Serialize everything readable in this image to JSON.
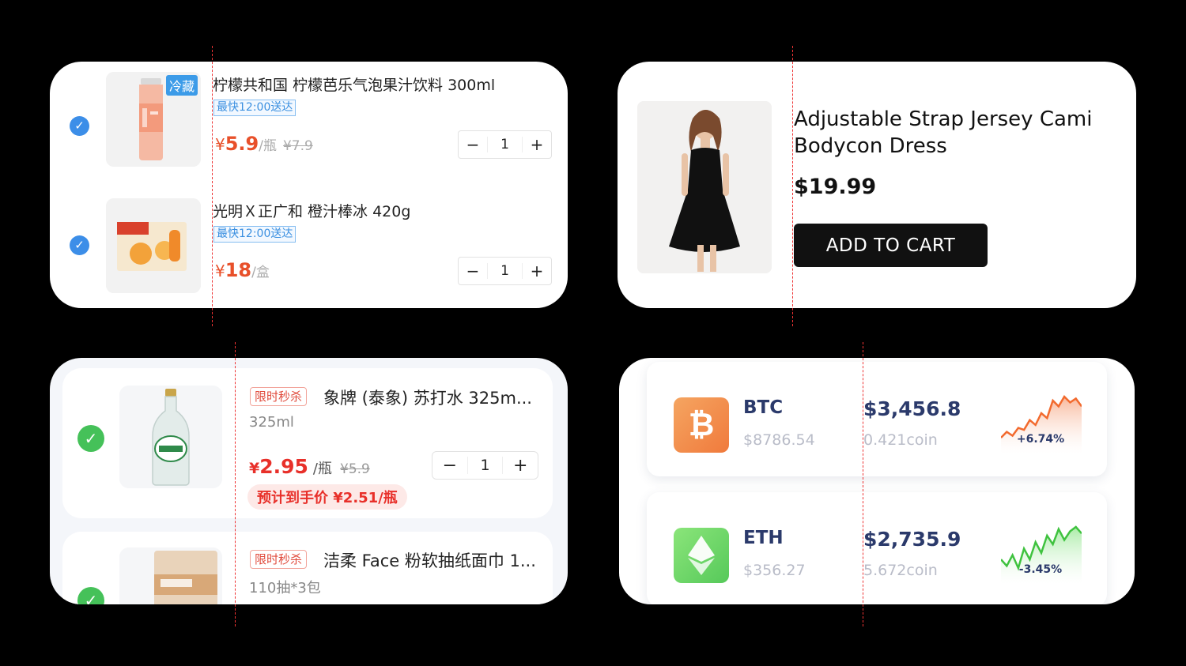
{
  "colors": {
    "accent_blue": "#3c8ee8",
    "price_red": "#e8502a",
    "check_green": "#45c159",
    "btc_orange": "#f07a3c",
    "eth_green": "#6ed35e",
    "dark_navy": "#2b3a6b"
  },
  "grocery_cart": {
    "items": [
      {
        "title": "柠檬共和国 柠檬芭乐气泡果汁饮料 300ml",
        "image_badge": "冷藏",
        "delivery_tag": "最快12:00送达",
        "currency": "¥",
        "price": "5.9",
        "unit": "/瓶",
        "original_price": "¥7.9",
        "quantity": "1",
        "image_icon": "juice-bottle-icon"
      },
      {
        "title": "光明Ｘ正广和 橙汁棒冰 420g",
        "delivery_tag": "最快12:00送达",
        "currency": "¥",
        "price": "18",
        "unit": "/盒",
        "quantity": "1",
        "image_icon": "popsicle-box-icon"
      }
    ],
    "minus": "−",
    "plus": "+",
    "check": "✓"
  },
  "product": {
    "title": "Adjustable Strap Jersey Cami Bodycon Dress",
    "price": "$19.99",
    "add_to_cart": "ADD TO CART",
    "image_icon": "black-dress-photo"
  },
  "flash_cart": {
    "items": [
      {
        "badge": "限时秒杀",
        "title": "象牌 (泰象) 苏打水 325m...",
        "subtitle": "325ml",
        "currency": "¥",
        "price": "2.95",
        "unit": "/瓶",
        "original_price": "¥5.9",
        "quantity": "1",
        "estimate": "预计到手价 ¥2.51/瓶",
        "image_icon": "soda-bottle-icon"
      },
      {
        "badge": "限时秒杀",
        "title": "洁柔 Face 粉软抽纸面巾 1...",
        "subtitle": "110抽*3包",
        "image_icon": "tissue-pack-icon"
      }
    ],
    "minus": "−",
    "plus": "+",
    "check": "✓"
  },
  "crypto": {
    "coins": [
      {
        "symbol": "BTC",
        "price": "$8786.54",
        "value": "$3,456.8",
        "holding": "0.421coin",
        "change": "+6.74%",
        "icon": "bitcoin-icon",
        "glyph": "₿",
        "trend_values": [
          20,
          26,
          22,
          30,
          28,
          38,
          33,
          45,
          40,
          58,
          52,
          62,
          56,
          60,
          52
        ]
      },
      {
        "symbol": "ETH",
        "price": "$356.27",
        "value": "$2,735.9",
        "holding": "5.672coin",
        "change": "-3.45%",
        "icon": "ethereum-icon",
        "glyph": "◆",
        "trend_values": [
          30,
          24,
          34,
          22,
          40,
          30,
          46,
          36,
          52,
          44,
          58,
          48,
          56,
          60,
          54
        ]
      }
    ]
  }
}
